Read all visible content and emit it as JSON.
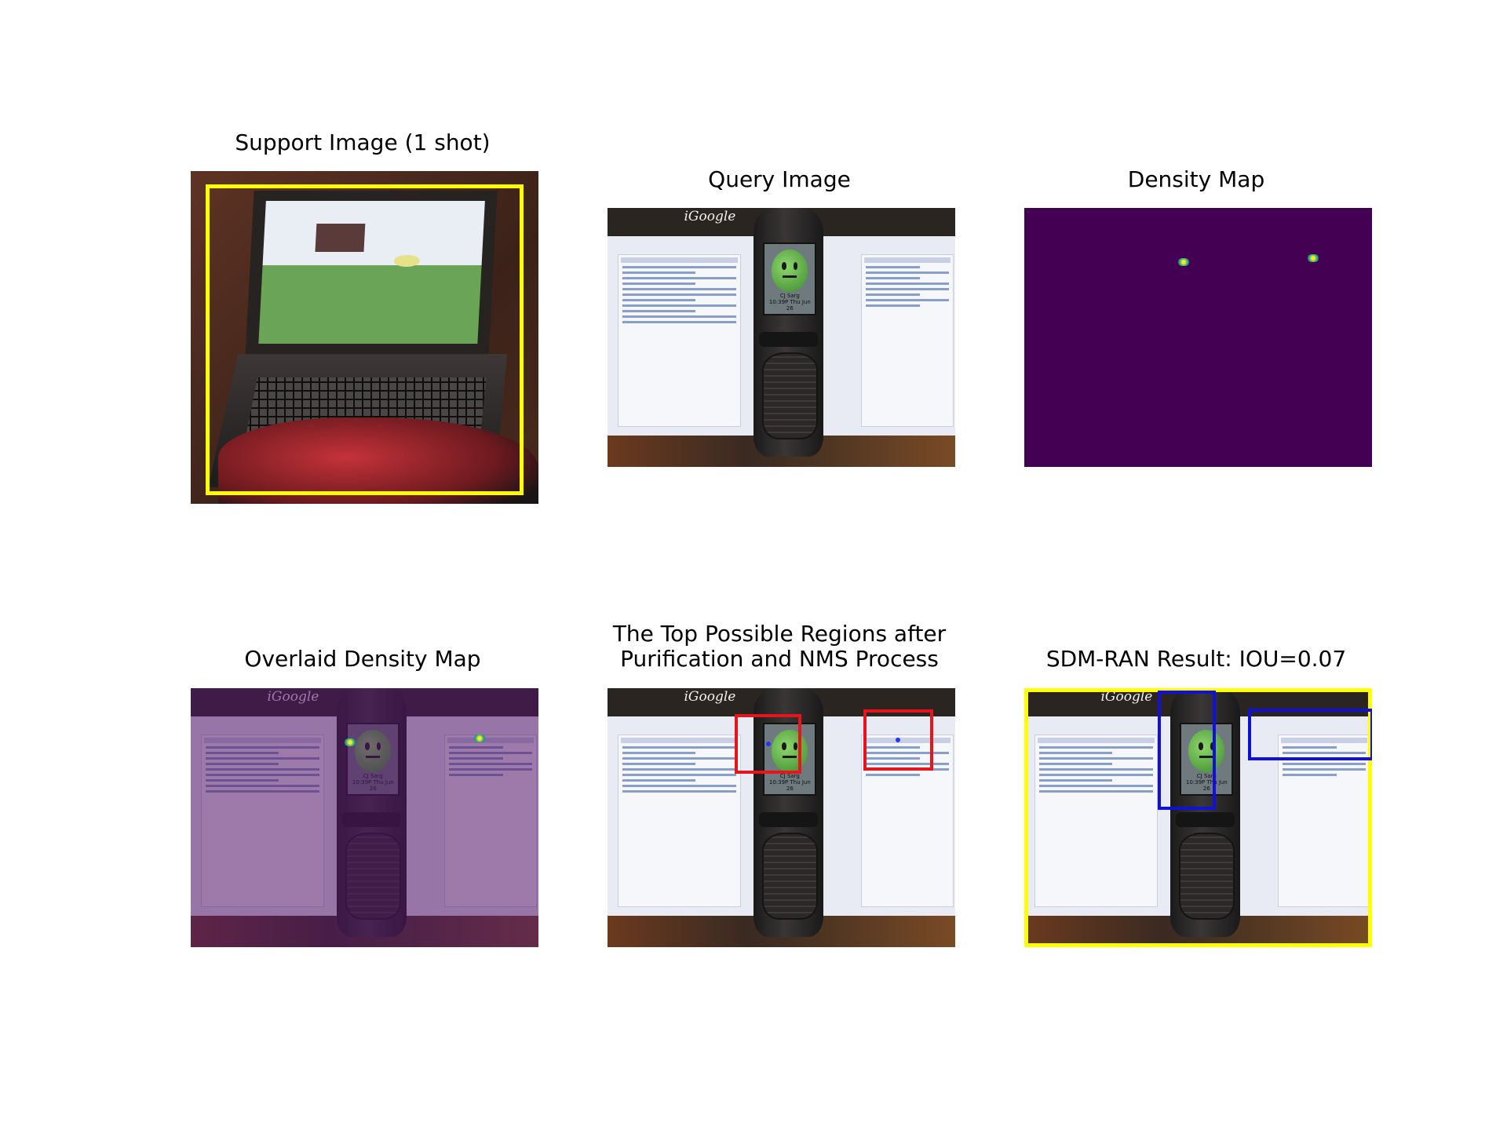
{
  "figure": {
    "titles": {
      "support": "Support Image (1 shot)",
      "query": "Query Image",
      "density": "Density Map",
      "overlay": "Overlaid Density Map",
      "regions_line1": "The Top Possible Regions after",
      "regions_line2": "Purification and NMS Process",
      "result": "SDM-RAN Result: IOU=0.07"
    },
    "query_screen_text": {
      "logo": "iGoogle",
      "phone_caption_line1": "CJ Sarg",
      "phone_caption_line2": "10:39P Thu Jun 26"
    },
    "colors": {
      "ground_truth_box": "#ffff00",
      "candidate_box": "#e8141c",
      "prediction_box": "#1010d8",
      "density_background": "#440154",
      "density_peak": "#fde725"
    },
    "density_peaks": 2,
    "candidate_regions": 2,
    "predicted_boxes": 2
  }
}
